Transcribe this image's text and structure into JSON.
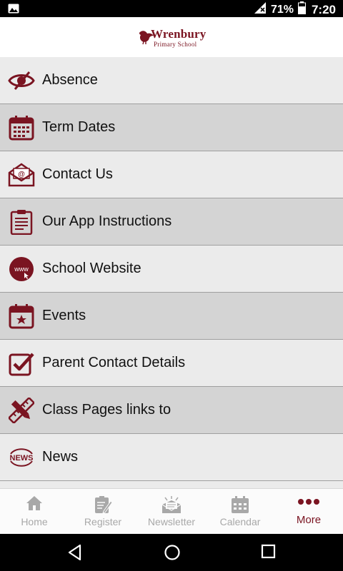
{
  "status_bar": {
    "battery_percent": "71%",
    "time": "7:20",
    "icons": [
      "image-icon",
      "signal-icon",
      "battery-icon"
    ]
  },
  "header": {
    "logo_name": "Wrenbury",
    "logo_subtitle": "Primary School"
  },
  "theme": {
    "accent": "#7a1421",
    "row_light": "#ebebeb",
    "row_dark": "#d4d4d4",
    "tab_inactive": "#a8a8a8"
  },
  "menu": {
    "items": [
      {
        "label": "Absence",
        "icon": "eye-slash-icon"
      },
      {
        "label": "Term Dates",
        "icon": "calendar-grid-icon"
      },
      {
        "label": "Contact Us",
        "icon": "envelope-at-icon"
      },
      {
        "label": "Our App Instructions",
        "icon": "clipboard-icon"
      },
      {
        "label": "School Website",
        "icon": "www-globe-icon"
      },
      {
        "label": "Events",
        "icon": "calendar-star-icon"
      },
      {
        "label": "Parent Contact Details",
        "icon": "checkbox-icon"
      },
      {
        "label": "Class Pages links to",
        "icon": "pencil-ruler-icon"
      },
      {
        "label": "News",
        "icon": "news-icon"
      }
    ]
  },
  "tabs": [
    {
      "label": "Home",
      "icon": "home-icon"
    },
    {
      "label": "Register",
      "icon": "register-icon"
    },
    {
      "label": "Newsletter",
      "icon": "newsletter-icon"
    },
    {
      "label": "Calendar",
      "icon": "calendar-icon"
    },
    {
      "label": "More",
      "icon": "more-dots-icon",
      "active": true
    }
  ],
  "nav_bar": [
    "back-icon",
    "home-circle-icon",
    "recents-square-icon"
  ]
}
